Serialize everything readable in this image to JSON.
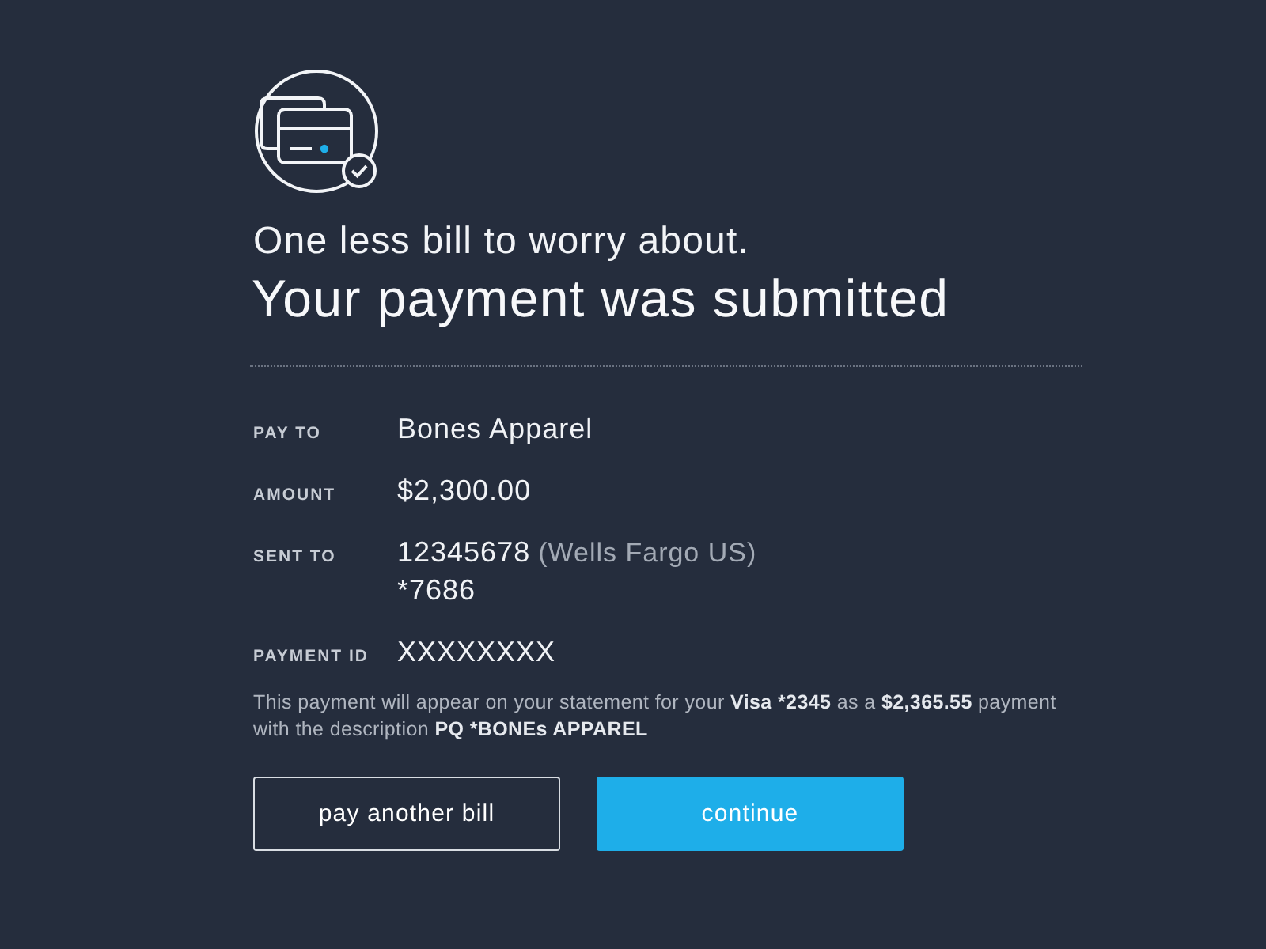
{
  "header": {
    "subtitle": "One less bill to worry about.",
    "title": "Your payment was submitted"
  },
  "details": [
    {
      "label": "PAY TO",
      "value": "Bones Apparel"
    },
    {
      "label": "AMOUNT",
      "value": "$2,300.00"
    },
    {
      "label": "SENT TO",
      "value": "12345678",
      "bank": "(Wells Fargo US)",
      "account": "*7686"
    },
    {
      "label": "PAYMENT ID",
      "value": "XXXXXXXX"
    }
  ],
  "notice": [
    {
      "text": "This payment will appear on your statement for your ",
      "bold": false
    },
    {
      "text": "Visa *2345",
      "bold": true
    },
    {
      "text": " as a ",
      "bold": false
    },
    {
      "text": "$2,365.55",
      "bold": true
    },
    {
      "text": " payment with the description ",
      "bold": false
    },
    {
      "text": "PQ *BONEs APPAREL",
      "bold": true
    }
  ],
  "buttons": [
    {
      "label": "pay another bill",
      "kind": "secondary"
    },
    {
      "label": "continue",
      "kind": "primary"
    }
  ]
}
